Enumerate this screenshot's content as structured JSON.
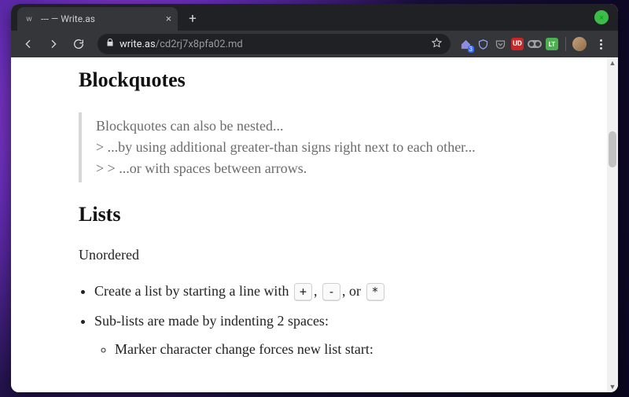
{
  "tab": {
    "title": "--- — Write.as",
    "favicon_char": "w"
  },
  "toolbar": {
    "url_host": "write.as",
    "url_path": "/cd2rj7x8pfa02.md",
    "ext_badge": "3",
    "ublock_label": "UD",
    "lt_label": "LT"
  },
  "page": {
    "h_blockquotes": "Blockquotes",
    "bq_line1": "Blockquotes can also be nested...",
    "bq_line2": "> ...by using additional greater-than signs right next to each other...",
    "bq_line3": "> > ...or with spaces between arrows.",
    "h_lists": "Lists",
    "sub_unordered": "Unordered",
    "li1_a": "Create a list by starting a line with ",
    "li1_k1": "+",
    "li1_b": ", ",
    "li1_k2": "-",
    "li1_c": ", or ",
    "li1_k3": "*",
    "li2": "Sub-lists are made by indenting 2 spaces:",
    "li2a": "Marker character change forces new list start:"
  }
}
